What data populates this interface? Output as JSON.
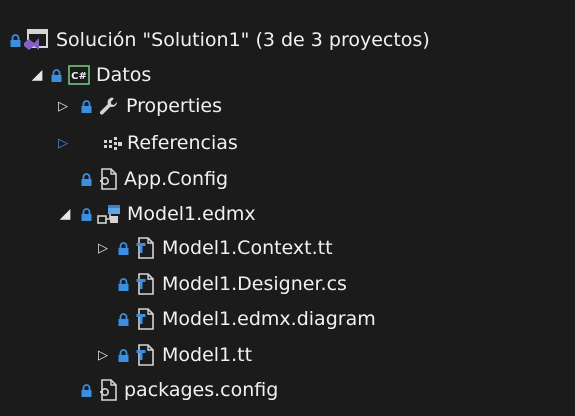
{
  "solution_explorer": {
    "solution": {
      "label": "Solución \"Solution1\" (3 de 3 proyectos)"
    },
    "project": {
      "label": "Datos",
      "type_badge": "C#"
    },
    "items": {
      "properties": {
        "label": "Properties",
        "icon": "wrench-icon"
      },
      "references": {
        "label": "Referencias",
        "icon": "references-icon"
      },
      "app_config": {
        "label": "App.Config",
        "icon": "config-file-icon"
      },
      "model_edmx": {
        "label": "Model1.edmx",
        "icon": "edmx-model-icon"
      },
      "context_tt": {
        "label": "Model1.Context.tt",
        "icon": "text-template-icon"
      },
      "designer_cs": {
        "label": "Model1.Designer.cs",
        "icon": "text-template-icon"
      },
      "edmx_diagram": {
        "label": "Model1.edmx.diagram",
        "icon": "text-template-icon"
      },
      "model_tt": {
        "label": "Model1.tt",
        "icon": "text-template-icon"
      },
      "packages_config": {
        "label": "packages.config",
        "icon": "config-file-icon"
      }
    },
    "colors": {
      "background": "#1b1b1c",
      "text": "#f1f1f1",
      "lock": "#3b8fe0",
      "csharp_badge": "#77c37a",
      "vs_logo": "#865fc5",
      "file_icon": "#d4d4d4",
      "edmx_icon": "#5fa6e8"
    }
  }
}
